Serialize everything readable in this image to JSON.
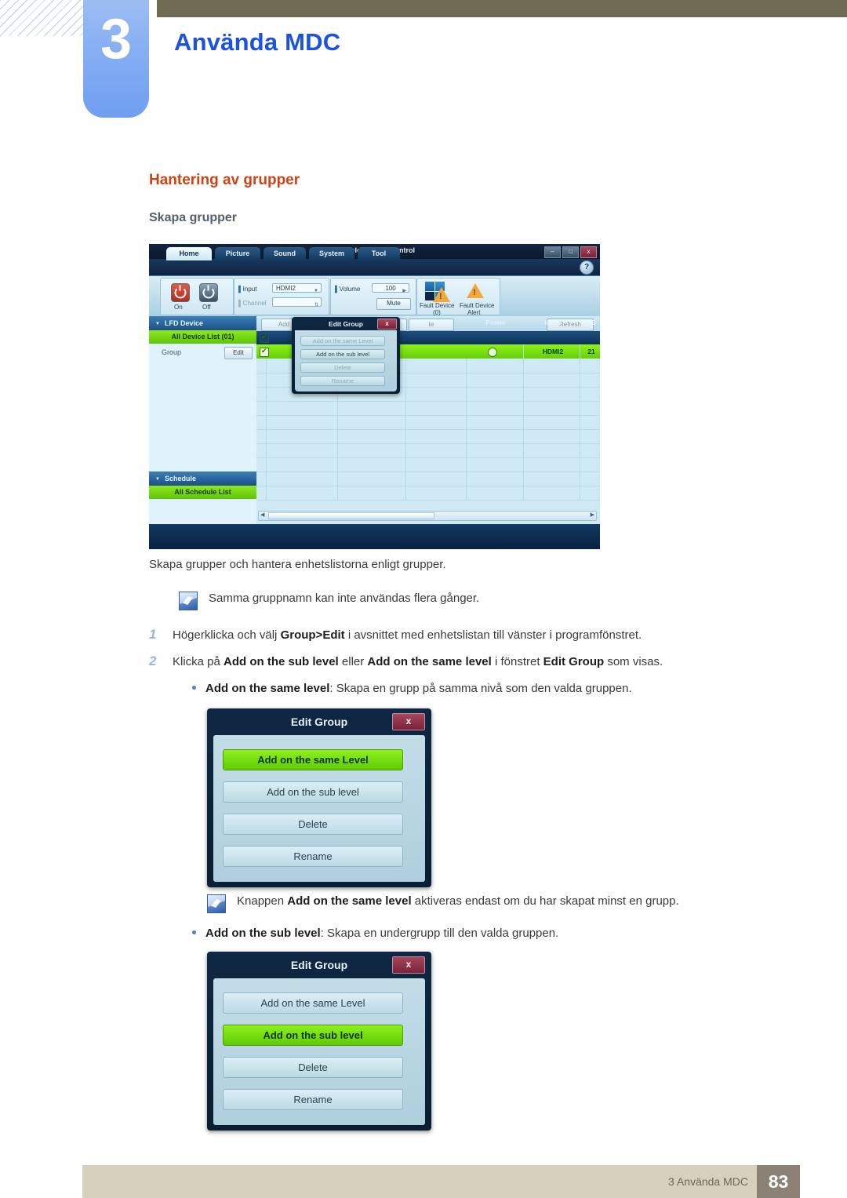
{
  "chapter": {
    "number": "3",
    "title": "Använda MDC"
  },
  "section": {
    "heading": "Hantering av grupper",
    "subheading": "Skapa grupper"
  },
  "intro_paragraph": "Skapa grupper och hantera enhetslistorna enligt grupper.",
  "notes": [
    {
      "icon": "note-icon",
      "text": "Samma gruppnamn kan inte användas flera gånger."
    },
    {
      "icon": "note-icon",
      "text_before": "Knappen ",
      "bold": "Add on the same level",
      "text_after": " aktiveras endast om du har skapat minst en grupp."
    }
  ],
  "steps": [
    {
      "number": "1",
      "t1": "Högerklicka och välj ",
      "b1": "Group>Edit",
      "t2": " i avsnittet med enhetslistan till vänster i programfönstret.",
      "b2": "",
      "t3": "",
      "b3": "",
      "t4": ""
    },
    {
      "number": "2",
      "t1": "Klicka på ",
      "b1": "Add on the sub level",
      "t2": " eller ",
      "b2": "Add on the same level",
      "t3": " i fönstret ",
      "b3": "Edit Group",
      "t4": " som visas."
    }
  ],
  "bullets": [
    {
      "bold": "Add on the same level",
      "text": ": Skapa en grupp på samma nivå som den valda gruppen."
    },
    {
      "bold": "Add on the sub level",
      "text": ": Skapa en undergrupp till den valda gruppen."
    }
  ],
  "mdc": {
    "window_title": "Multiple Display Control",
    "window_buttons": {
      "minimize": "–",
      "maximize": "□",
      "close": "x"
    },
    "help_label": "?",
    "tabs": [
      {
        "label": "Home",
        "active": true
      },
      {
        "label": "Picture",
        "active": false
      },
      {
        "label": "Sound",
        "active": false
      },
      {
        "label": "System",
        "active": false
      },
      {
        "label": "Tool",
        "active": false
      }
    ],
    "ribbon": {
      "power_on_label": "On",
      "power_off_label": "Off",
      "input_label": "Input",
      "input_value": "HDMI2",
      "channel_label": "Channel",
      "channel_value": "",
      "volume_label": "Volume",
      "volume_value": "100",
      "mute_label": "Mute",
      "fault_device_label": "Fault Device",
      "fault_device_count": "(0)",
      "fault_alert_label": "Fault Device",
      "fault_alert_label2": "Alert"
    },
    "sidebar": {
      "lfd_device_header": "LFD Device",
      "all_device_list": "All Device List (01)",
      "group_label": "Group",
      "group_edit_button": "Edit",
      "schedule_header": "Schedule",
      "all_schedule_list": "All Schedule List"
    },
    "toolbar_buttons": [
      {
        "label": "Add"
      },
      {
        "label": ""
      },
      {
        "label": ""
      },
      {
        "label": "te"
      },
      {
        "label": "Refresh"
      }
    ],
    "table": {
      "columns": [
        "",
        "",
        "",
        "Power",
        "Input",
        "S"
      ],
      "row": {
        "power": "",
        "input": "HDMI2",
        "extra": "21"
      }
    },
    "inline_dialog": {
      "title": "Edit Group",
      "close": "x",
      "buttons": [
        {
          "label": "Add on the same Level",
          "state": "disabled"
        },
        {
          "label": "Add on the sub level",
          "state": "normal"
        },
        {
          "label": "Delete",
          "state": "disabled"
        },
        {
          "label": "Rename",
          "state": "disabled"
        }
      ]
    }
  },
  "dialog_same_level": {
    "title": "Edit Group",
    "close": "x",
    "buttons": [
      {
        "label": "Add on the same Level",
        "state": "highlight"
      },
      {
        "label": "Add on the sub level",
        "state": "normal"
      },
      {
        "label": "Delete",
        "state": "normal"
      },
      {
        "label": "Rename",
        "state": "normal"
      }
    ]
  },
  "dialog_sub_level": {
    "title": "Edit Group",
    "close": "x",
    "buttons": [
      {
        "label": "Add on the same Level",
        "state": "normal"
      },
      {
        "label": "Add on the sub level",
        "state": "highlight"
      },
      {
        "label": "Delete",
        "state": "normal"
      },
      {
        "label": "Rename",
        "state": "normal"
      }
    ]
  },
  "footer": {
    "text": "3 Använda MDC",
    "page": "83"
  },
  "colors": {
    "chapter_accent": "#6f9ff0",
    "section_heading": "#cf4213",
    "title_blue": "#1a53e0",
    "olive": "#6f6b52",
    "footer_bg": "#d6d0bd",
    "page_box": "#8b8175",
    "highlight_green": "#8ef01c"
  }
}
